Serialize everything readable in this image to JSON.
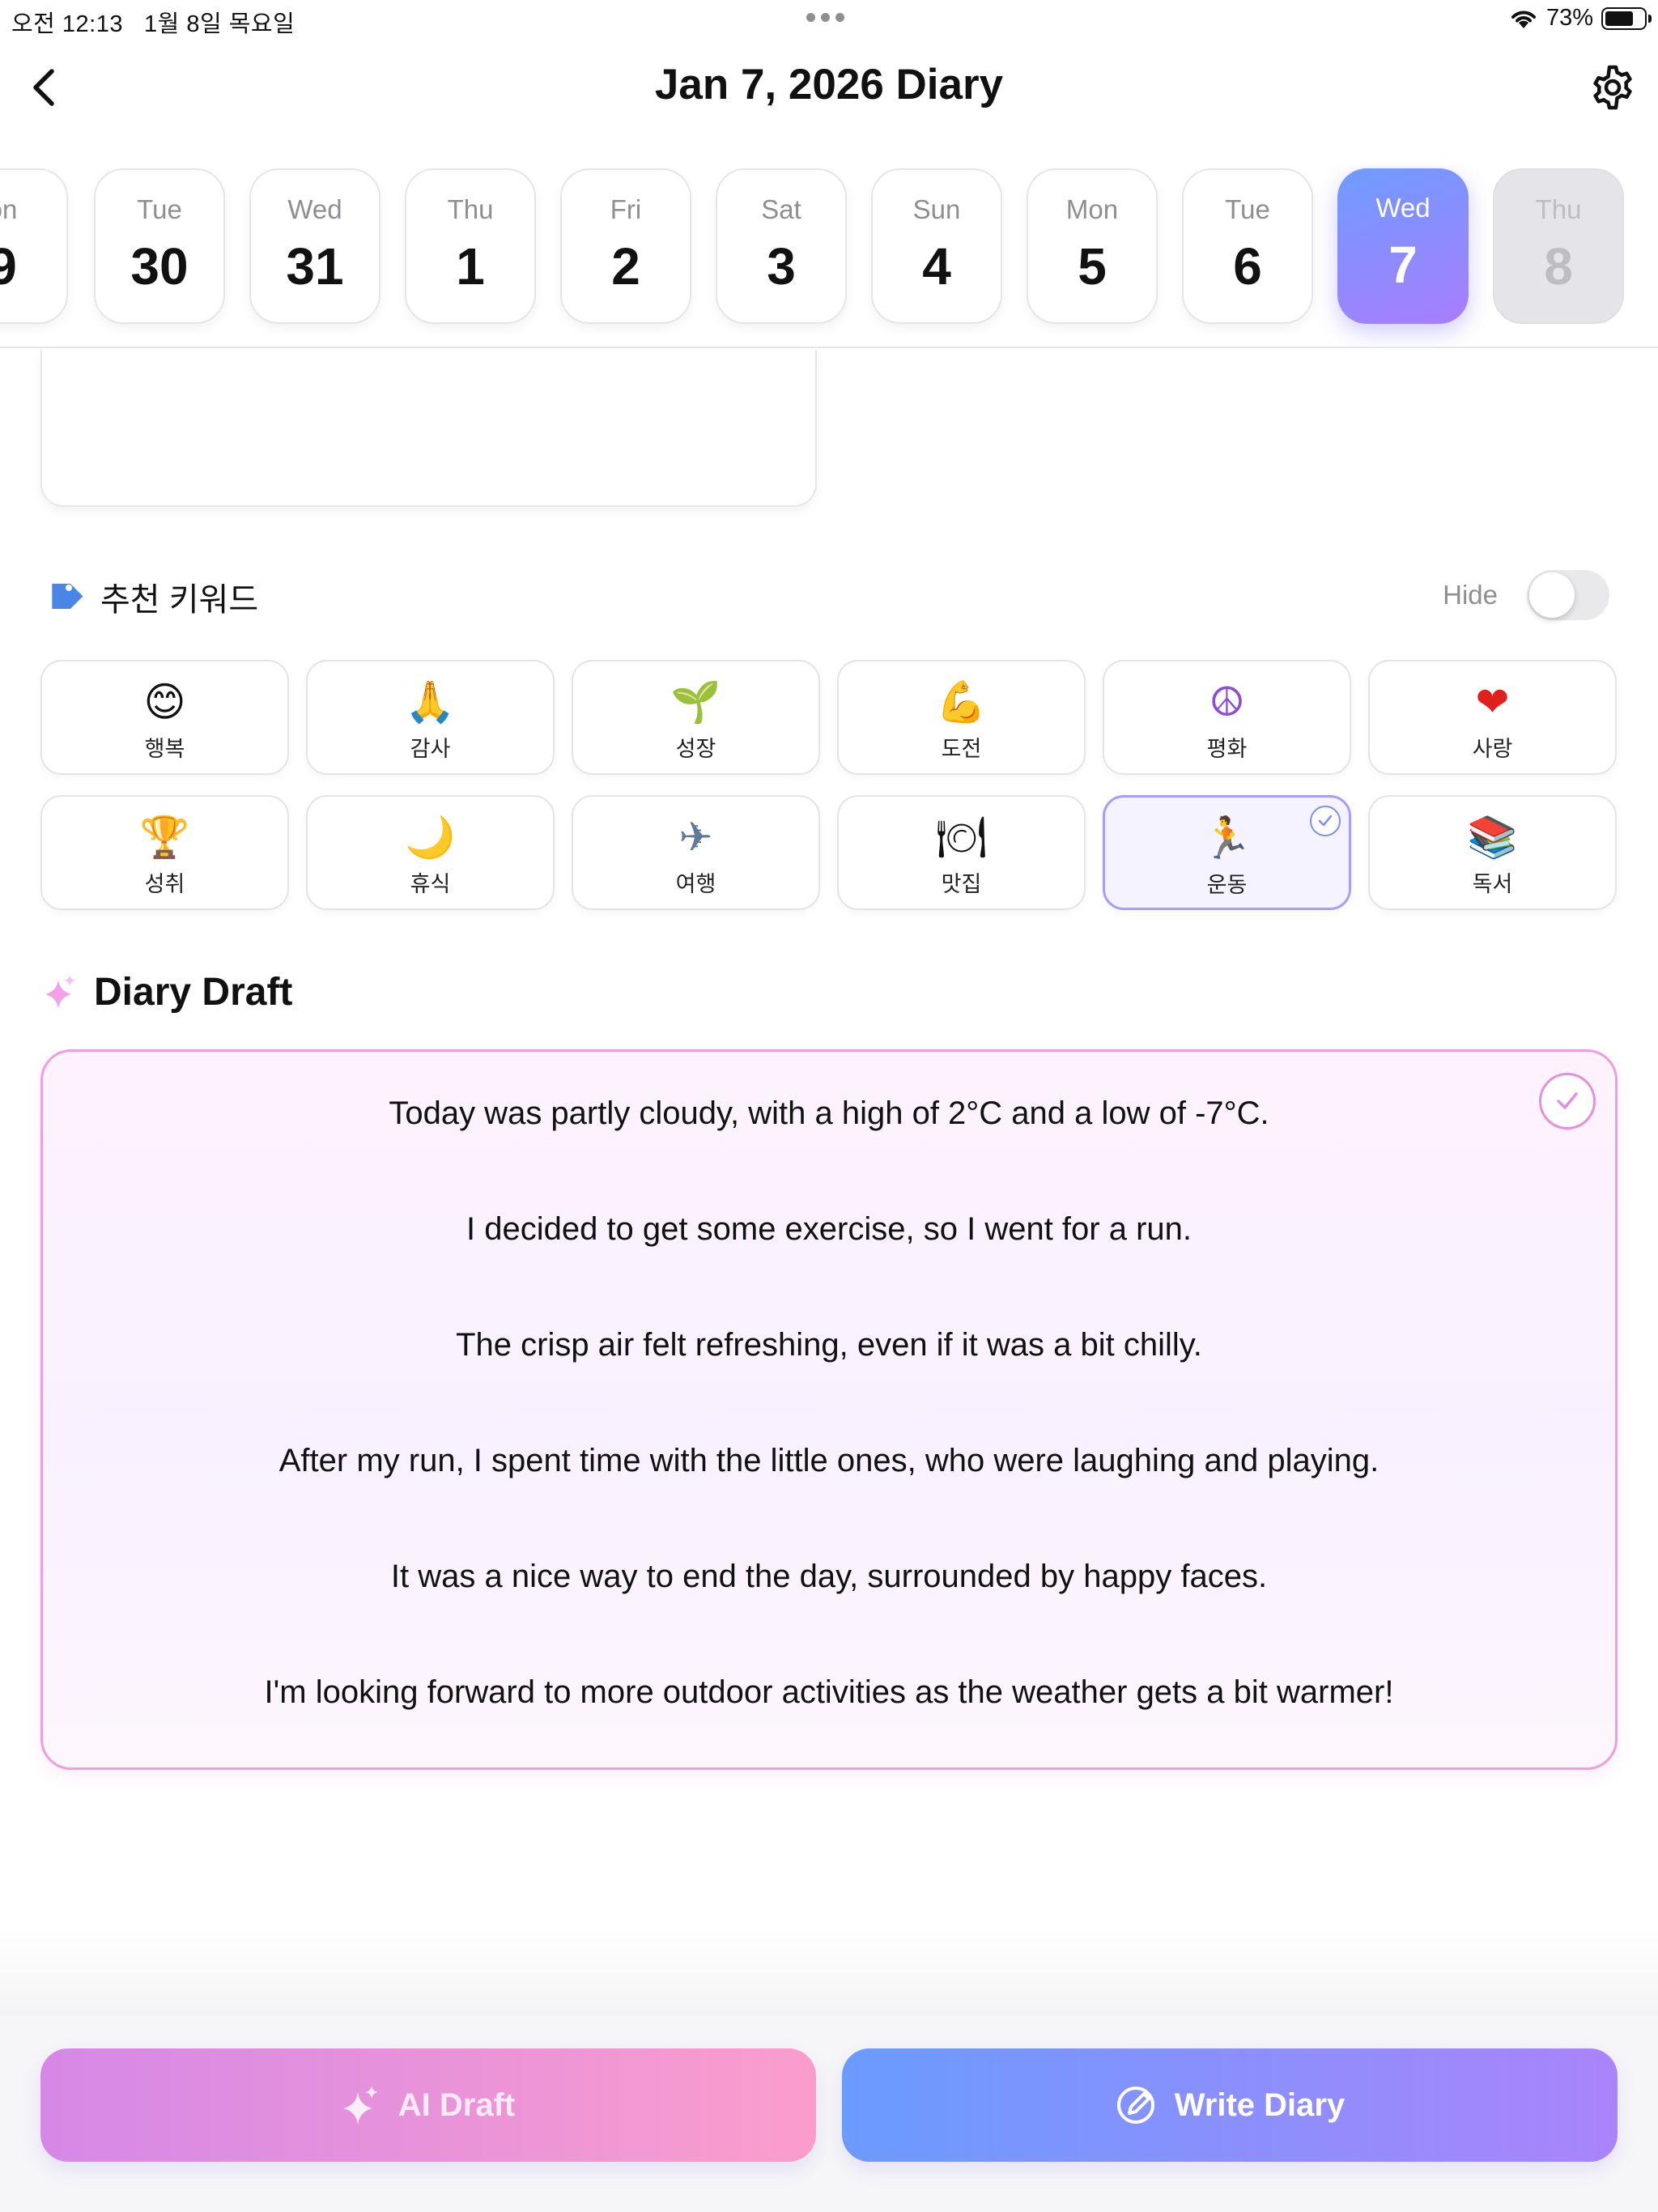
{
  "status_bar": {
    "time": "오전 12:13",
    "date": "1월 8일 목요일",
    "battery": "73%"
  },
  "nav": {
    "title": "Jan 7, 2026 Diary"
  },
  "dates": [
    {
      "dow": "on",
      "day": "9",
      "state": "normal"
    },
    {
      "dow": "Tue",
      "day": "30",
      "state": "normal"
    },
    {
      "dow": "Wed",
      "day": "31",
      "state": "normal"
    },
    {
      "dow": "Thu",
      "day": "1",
      "state": "normal"
    },
    {
      "dow": "Fri",
      "day": "2",
      "state": "normal"
    },
    {
      "dow": "Sat",
      "day": "3",
      "state": "normal"
    },
    {
      "dow": "Sun",
      "day": "4",
      "state": "normal"
    },
    {
      "dow": "Mon",
      "day": "5",
      "state": "normal"
    },
    {
      "dow": "Tue",
      "day": "6",
      "state": "normal"
    },
    {
      "dow": "Wed",
      "day": "7",
      "state": "selected"
    },
    {
      "dow": "Thu",
      "day": "8",
      "state": "future"
    }
  ],
  "keywords": {
    "title": "추천 키워드",
    "hide_label": "Hide",
    "hide_on": false,
    "items": [
      {
        "emoji": "😊",
        "label": "행복",
        "selected": false
      },
      {
        "emoji": "🙏",
        "label": "감사",
        "selected": false
      },
      {
        "emoji": "🌱",
        "label": "성장",
        "selected": false
      },
      {
        "emoji": "💪",
        "label": "도전",
        "selected": false
      },
      {
        "emoji": "☮",
        "label": "평화",
        "selected": false
      },
      {
        "emoji": "❤",
        "label": "사랑",
        "selected": false
      },
      {
        "emoji": "🏆",
        "label": "성취",
        "selected": false
      },
      {
        "emoji": "🌙",
        "label": "휴식",
        "selected": false
      },
      {
        "emoji": "✈",
        "label": "여행",
        "selected": false
      },
      {
        "emoji": "🍽",
        "label": "맛집",
        "selected": false
      },
      {
        "emoji": "🏃",
        "label": "운동",
        "selected": true
      },
      {
        "emoji": "📚",
        "label": "독서",
        "selected": false
      }
    ]
  },
  "draft": {
    "title": "Diary Draft",
    "lines": [
      "Today was partly cloudy, with a high of 2°C and a low of -7°C.",
      "I decided to get some exercise, so I went for a run.",
      "The crisp air felt refreshing, even if it was a bit chilly.",
      "After my run, I spent time with the little ones, who were laughing and playing.",
      "It was a nice way to end the day, surrounded by happy faces.",
      "I'm looking forward to more outdoor activities as the weather gets a bit warmer!"
    ]
  },
  "actions": {
    "ai_draft": "AI Draft",
    "write_diary": "Write Diary"
  }
}
